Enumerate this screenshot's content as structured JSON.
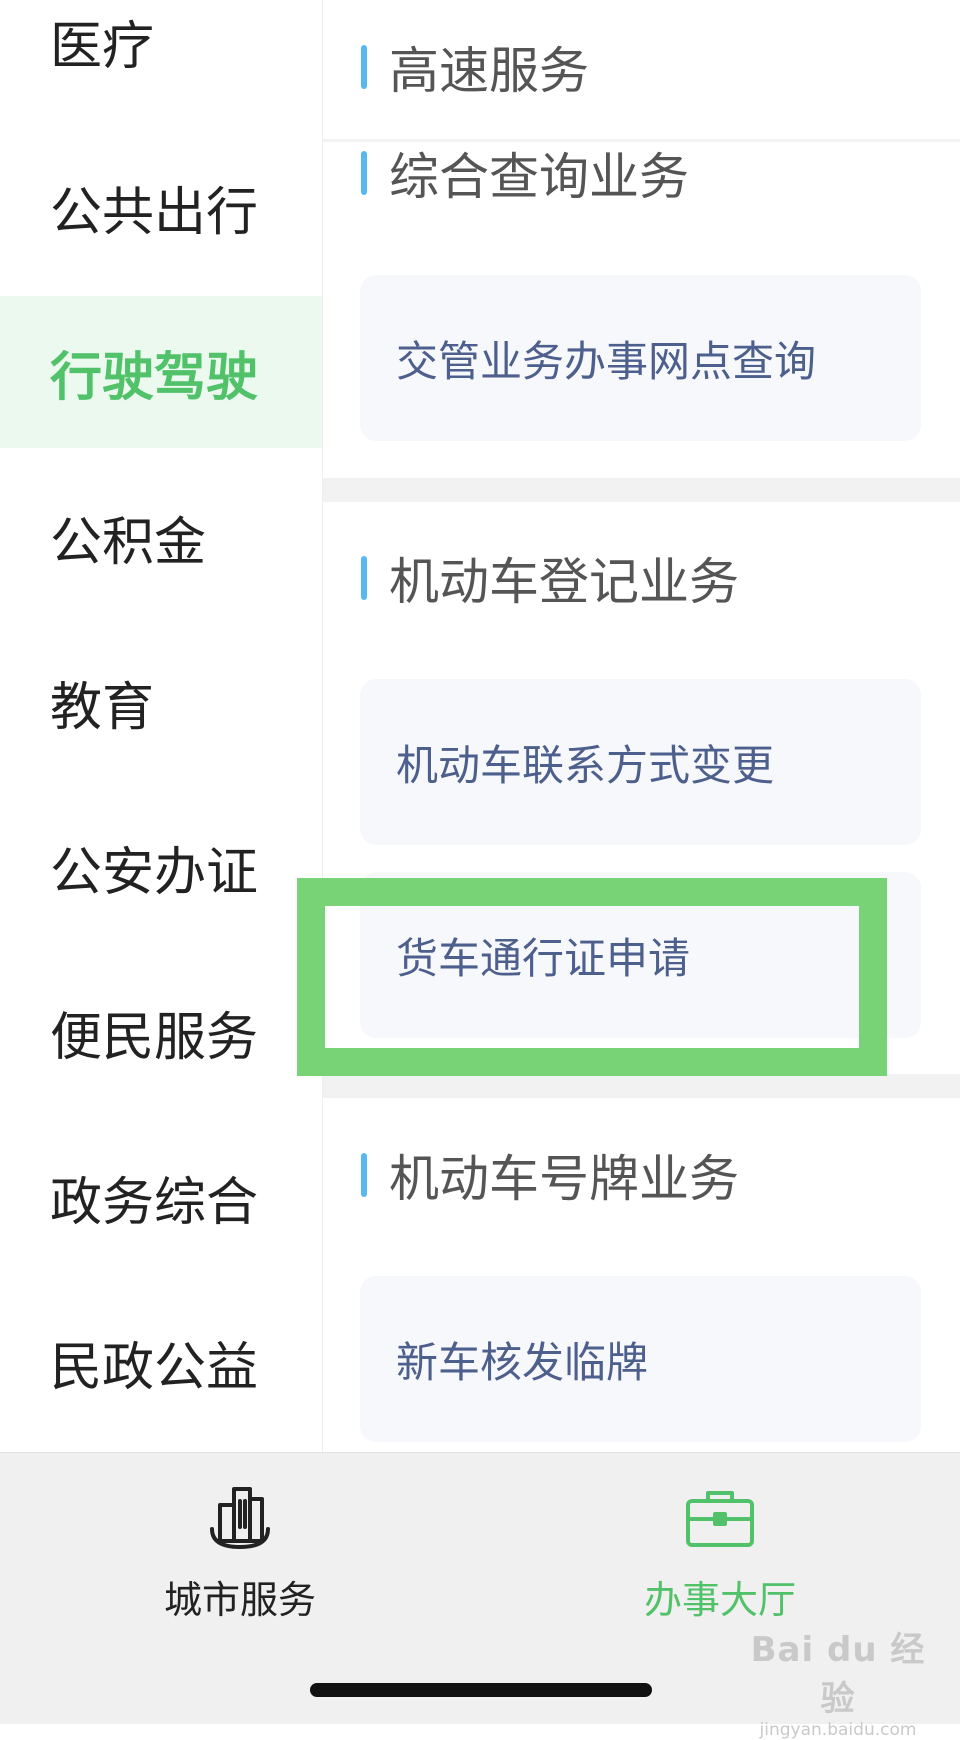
{
  "sidebar": {
    "items": [
      {
        "label": "医疗"
      },
      {
        "label": "公共出行"
      },
      {
        "label": "行驶驾驶",
        "active": true
      },
      {
        "label": "公积金"
      },
      {
        "label": "教育"
      },
      {
        "label": "公安办证"
      },
      {
        "label": "便民服务"
      },
      {
        "label": "政务综合"
      },
      {
        "label": "民政公益"
      }
    ]
  },
  "content": {
    "sections": [
      {
        "title": "高速服务",
        "items": []
      },
      {
        "title": "综合查询业务",
        "items": [
          "交管业务办事网点查询"
        ]
      },
      {
        "title": "机动车登记业务",
        "items": [
          "机动车联系方式变更",
          "货车通行证申请"
        ]
      },
      {
        "title": "机动车号牌业务",
        "items": [
          "新车核发临牌"
        ]
      }
    ]
  },
  "tabbar": {
    "tabs": [
      {
        "label": "城市服务",
        "icon": "city-buildings-icon"
      },
      {
        "label": "办事大厅",
        "icon": "briefcase-icon",
        "active": true
      }
    ]
  },
  "watermark": {
    "main": "Bai du 经验",
    "sub": "jingyan.baidu.com"
  },
  "colors": {
    "accent_green": "#52c26a",
    "active_bg": "#ebf9ef",
    "section_bar_blue": "#58b8f0",
    "card_text": "#4d5f8c",
    "highlight_green": "#78d377"
  }
}
